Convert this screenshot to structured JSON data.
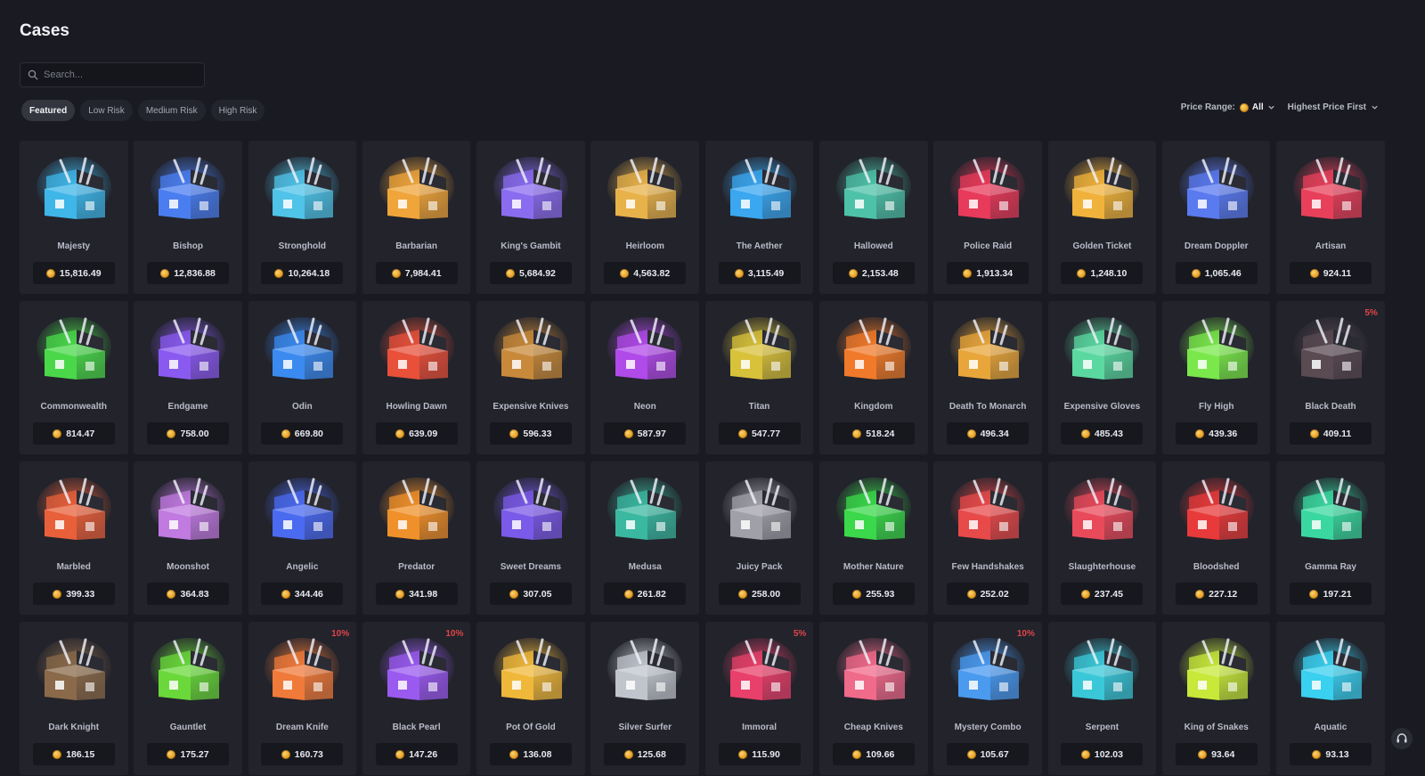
{
  "page": {
    "title": "Cases"
  },
  "search": {
    "placeholder": "Search..."
  },
  "filters": [
    {
      "label": "Featured",
      "active": true
    },
    {
      "label": "Low Risk",
      "active": false
    },
    {
      "label": "Medium Risk",
      "active": false
    },
    {
      "label": "High Risk",
      "active": false
    }
  ],
  "sort": {
    "price_range_label": "Price Range:",
    "price_range_value": "All",
    "order": "Highest Price First"
  },
  "colors": {
    "background": "#1a1b22",
    "card": "#22232b",
    "coin": "#e09a1f",
    "badge": "#e0454a"
  },
  "cases": [
    {
      "name": "Majesty",
      "price": "15,816.49",
      "color": "#3fb6e8"
    },
    {
      "name": "Bishop",
      "price": "12,836.88",
      "color": "#4a7ef0"
    },
    {
      "name": "Stronghold",
      "price": "10,264.18",
      "color": "#4fc3e8"
    },
    {
      "name": "Barbarian",
      "price": "7,984.41",
      "color": "#f0a53a"
    },
    {
      "name": "King's Gambit",
      "price": "5,684.92",
      "color": "#8a6cf0"
    },
    {
      "name": "Heirloom",
      "price": "4,563.82",
      "color": "#e8b24a"
    },
    {
      "name": "The Aether",
      "price": "3,115.49",
      "color": "#3aa7f0"
    },
    {
      "name": "Hallowed",
      "price": "2,153.48",
      "color": "#4ec2a8"
    },
    {
      "name": "Police Raid",
      "price": "1,913.34",
      "color": "#e83a5a"
    },
    {
      "name": "Golden Ticket",
      "price": "1,248.10",
      "color": "#f0b23a"
    },
    {
      "name": "Dream Doppler",
      "price": "1,065.46",
      "color": "#5a7af0"
    },
    {
      "name": "Artisan",
      "price": "924.11",
      "color": "#e8405a"
    },
    {
      "name": "Commonwealth",
      "price": "814.47",
      "color": "#4ad84a"
    },
    {
      "name": "Endgame",
      "price": "758.00",
      "color": "#8a5af0"
    },
    {
      "name": "Odin",
      "price": "669.80",
      "color": "#3a8af0"
    },
    {
      "name": "Howling Dawn",
      "price": "639.09",
      "color": "#e8503a"
    },
    {
      "name": "Expensive Knives",
      "price": "596.33",
      "color": "#c88a3a"
    },
    {
      "name": "Neon",
      "price": "587.97",
      "color": "#b04ae8"
    },
    {
      "name": "Titan",
      "price": "547.77",
      "color": "#d8c23a"
    },
    {
      "name": "Kingdom",
      "price": "518.24",
      "color": "#f07a2a"
    },
    {
      "name": "Death To Monarch",
      "price": "496.34",
      "color": "#e8a63a"
    },
    {
      "name": "Expensive Gloves",
      "price": "485.43",
      "color": "#5ad8a0"
    },
    {
      "name": "Fly High",
      "price": "439.36",
      "color": "#7ae84a"
    },
    {
      "name": "Black Death",
      "price": "409.11",
      "color": "#5a4a52",
      "badge": "5%"
    },
    {
      "name": "Marbled",
      "price": "399.33",
      "color": "#e8603a"
    },
    {
      "name": "Moonshot",
      "price": "364.83",
      "color": "#c07ae0"
    },
    {
      "name": "Angelic",
      "price": "344.46",
      "color": "#4a6af0"
    },
    {
      "name": "Predator",
      "price": "341.98",
      "color": "#f0902a"
    },
    {
      "name": "Sweet Dreams",
      "price": "307.05",
      "color": "#7a5ae8"
    },
    {
      "name": "Medusa",
      "price": "261.82",
      "color": "#3ab8a0"
    },
    {
      "name": "Juicy Pack",
      "price": "258.00",
      "color": "#a0a0a8"
    },
    {
      "name": "Mother Nature",
      "price": "255.93",
      "color": "#3ad84a"
    },
    {
      "name": "Few Handshakes",
      "price": "252.02",
      "color": "#e84a4a"
    },
    {
      "name": "Slaughterhouse",
      "price": "237.45",
      "color": "#e84a5a"
    },
    {
      "name": "Bloodshed",
      "price": "227.12",
      "color": "#e83a3a"
    },
    {
      "name": "Gamma Ray",
      "price": "197.21",
      "color": "#3ad8a0"
    },
    {
      "name": "Dark Knight",
      "price": "186.15",
      "color": "#8a6a4a"
    },
    {
      "name": "Gauntlet",
      "price": "175.27",
      "color": "#6ad83a"
    },
    {
      "name": "Dream Knife",
      "price": "160.73",
      "color": "#f07a3a",
      "badge": "10%"
    },
    {
      "name": "Black Pearl",
      "price": "147.26",
      "color": "#9a5af0",
      "badge": "10%"
    },
    {
      "name": "Pot Of Gold",
      "price": "136.08",
      "color": "#f0b83a"
    },
    {
      "name": "Silver Surfer",
      "price": "125.68",
      "color": "#c0c4cc"
    },
    {
      "name": "Immoral",
      "price": "115.90",
      "color": "#e8406a",
      "badge": "5%"
    },
    {
      "name": "Cheap Knives",
      "price": "109.66",
      "color": "#f06a8a"
    },
    {
      "name": "Mystery Combo",
      "price": "105.67",
      "color": "#4a9af0",
      "badge": "10%"
    },
    {
      "name": "Serpent",
      "price": "102.03",
      "color": "#3ac8d8"
    },
    {
      "name": "King of Snakes",
      "price": "93.64",
      "color": "#c8e83a"
    },
    {
      "name": "Aquatic",
      "price": "93.13",
      "color": "#3ad0f0"
    }
  ]
}
